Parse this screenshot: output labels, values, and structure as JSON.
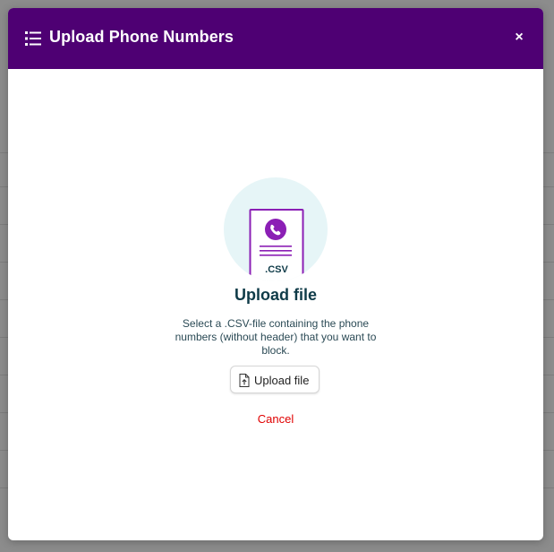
{
  "modal": {
    "title": "Upload Phone Numbers",
    "close_label": "×",
    "title_icon": "list-icon",
    "close_icon": "close-icon"
  },
  "illustration": {
    "file_extension": ".CSV",
    "icon": "phone-icon"
  },
  "content": {
    "heading": "Upload file",
    "description": "Select a .CSV-file containing the phone numbers (without header) that you want to block."
  },
  "actions": {
    "upload_label": "Upload file",
    "upload_icon": "file-upload-icon",
    "cancel_label": "Cancel"
  },
  "colors": {
    "header_bg": "#4e0073",
    "accent": "#8b1fb5",
    "illustration_bg": "#e6f5f7",
    "cancel": "#e00000",
    "heading": "#0f3b48"
  }
}
